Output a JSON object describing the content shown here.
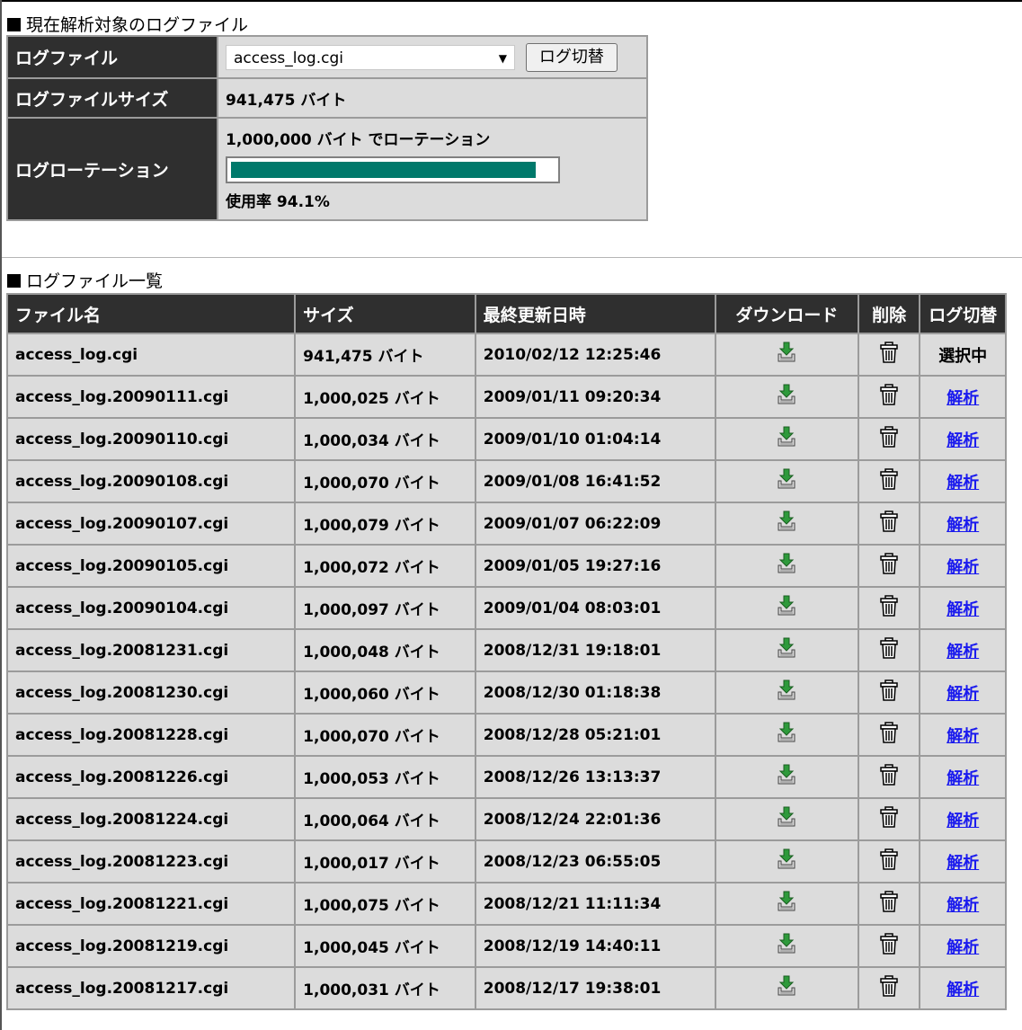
{
  "current_section": {
    "title": "現在解析対象のログファイル",
    "logfile_label": "ログファイル",
    "selected_file": "access_log.cgi",
    "switch_button": "ログ切替",
    "size_label": "ログファイルサイズ",
    "size_value": "941,475 バイト",
    "rotation_label": "ログローテーション",
    "rotation_text": "1,000,000 バイト でローテーション",
    "usage_text": "使用率 94.1%",
    "usage_fraction": 0.941,
    "bar_color": "#00796b"
  },
  "list_section": {
    "title": "ログファイル一覧",
    "headers": [
      "ファイル名",
      "サイズ",
      "最終更新日時",
      "ダウンロード",
      "削除",
      "ログ切替"
    ],
    "rows": [
      {
        "name": "access_log.cgi",
        "size": "941,475 バイト",
        "date": "2010/02/12 12:25:46",
        "action": "選択中",
        "link": false
      },
      {
        "name": "access_log.20090111.cgi",
        "size": "1,000,025 バイト",
        "date": "2009/01/11 09:20:34",
        "action": "解析",
        "link": true
      },
      {
        "name": "access_log.20090110.cgi",
        "size": "1,000,034 バイト",
        "date": "2009/01/10 01:04:14",
        "action": "解析",
        "link": true
      },
      {
        "name": "access_log.20090108.cgi",
        "size": "1,000,070 バイト",
        "date": "2009/01/08 16:41:52",
        "action": "解析",
        "link": true
      },
      {
        "name": "access_log.20090107.cgi",
        "size": "1,000,079 バイト",
        "date": "2009/01/07 06:22:09",
        "action": "解析",
        "link": true
      },
      {
        "name": "access_log.20090105.cgi",
        "size": "1,000,072 バイト",
        "date": "2009/01/05 19:27:16",
        "action": "解析",
        "link": true
      },
      {
        "name": "access_log.20090104.cgi",
        "size": "1,000,097 バイト",
        "date": "2009/01/04 08:03:01",
        "action": "解析",
        "link": true
      },
      {
        "name": "access_log.20081231.cgi",
        "size": "1,000,048 バイト",
        "date": "2008/12/31 19:18:01",
        "action": "解析",
        "link": true
      },
      {
        "name": "access_log.20081230.cgi",
        "size": "1,000,060 バイト",
        "date": "2008/12/30 01:18:38",
        "action": "解析",
        "link": true
      },
      {
        "name": "access_log.20081228.cgi",
        "size": "1,000,070 バイト",
        "date": "2008/12/28 05:21:01",
        "action": "解析",
        "link": true
      },
      {
        "name": "access_log.20081226.cgi",
        "size": "1,000,053 バイト",
        "date": "2008/12/26 13:13:37",
        "action": "解析",
        "link": true
      },
      {
        "name": "access_log.20081224.cgi",
        "size": "1,000,064 バイト",
        "date": "2008/12/24 22:01:36",
        "action": "解析",
        "link": true
      },
      {
        "name": "access_log.20081223.cgi",
        "size": "1,000,017 バイト",
        "date": "2008/12/23 06:55:05",
        "action": "解析",
        "link": true
      },
      {
        "name": "access_log.20081221.cgi",
        "size": "1,000,075 バイト",
        "date": "2008/12/21 11:11:34",
        "action": "解析",
        "link": true
      },
      {
        "name": "access_log.20081219.cgi",
        "size": "1,000,045 バイト",
        "date": "2008/12/19 14:40:11",
        "action": "解析",
        "link": true
      },
      {
        "name": "access_log.20081217.cgi",
        "size": "1,000,031 バイト",
        "date": "2008/12/17 19:38:01",
        "action": "解析",
        "link": true
      }
    ]
  },
  "icons": {
    "download": "download-tray-icon",
    "delete": "trash-can-icon"
  }
}
